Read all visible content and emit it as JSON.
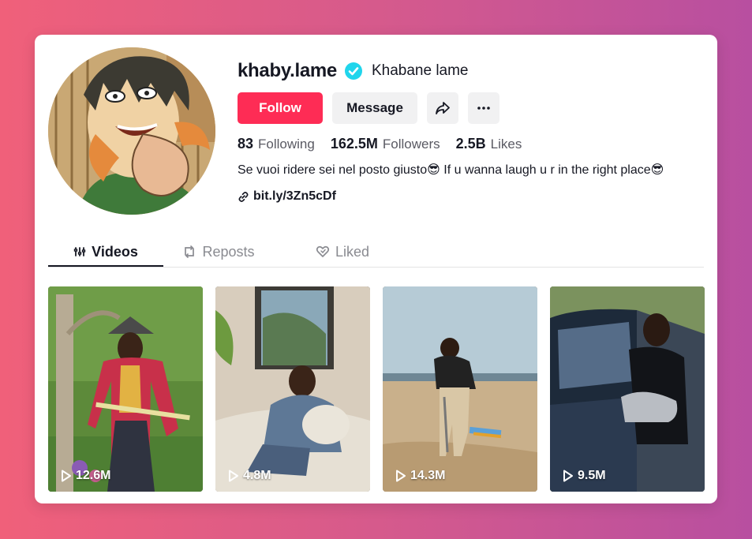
{
  "profile": {
    "username": "khaby.lame",
    "nickname": "Khabane lame",
    "verified": true,
    "bio": "Se vuoi ridere sei nel posto giusto😎 If u wanna laugh u r in the right place😎",
    "link": "bit.ly/3Zn5cDf"
  },
  "actions": {
    "follow_label": "Follow",
    "message_label": "Message",
    "share_icon": "share-icon",
    "more_icon": "more-icon"
  },
  "stats": [
    {
      "value": "83",
      "label": "Following"
    },
    {
      "value": "162.5M",
      "label": "Followers"
    },
    {
      "value": "2.5B",
      "label": "Likes"
    }
  ],
  "tabs": [
    {
      "label": "Videos",
      "icon": "grid-icon",
      "active": true
    },
    {
      "label": "Reposts",
      "icon": "repost-icon",
      "active": false
    },
    {
      "label": "Liked",
      "icon": "heart-icon",
      "active": false
    }
  ],
  "videos": [
    {
      "views": "12.6M"
    },
    {
      "views": "4.8M"
    },
    {
      "views": "14.3M"
    },
    {
      "views": "9.5M"
    }
  ],
  "colors": {
    "accent": "#fe2c55",
    "verified": "#20d5ec",
    "background_left": "#f0607a",
    "background_right": "#b84fa0"
  }
}
